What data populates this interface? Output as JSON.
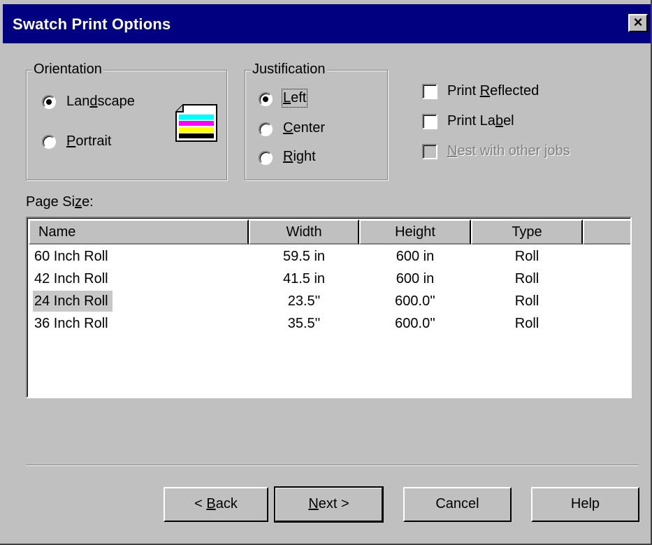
{
  "window": {
    "title": "Swatch Print Options",
    "close_symbol": "×"
  },
  "orientation": {
    "group_label": "Orientation",
    "options": [
      {
        "label_pre": "Lan",
        "label_u": "d",
        "label_post": "scape",
        "selected": true
      },
      {
        "label_pre": "",
        "label_u": "P",
        "label_post": "ortrait",
        "selected": false
      }
    ],
    "icon": "landscape-page-icon"
  },
  "justification": {
    "group_label": "Justification",
    "options": [
      {
        "label_pre": "",
        "label_u": "L",
        "label_post": "eft",
        "selected": true
      },
      {
        "label_pre": "",
        "label_u": "C",
        "label_post": "enter",
        "selected": false
      },
      {
        "label_pre": "",
        "label_u": "R",
        "label_post": "ight",
        "selected": false
      }
    ]
  },
  "checkboxes": [
    {
      "label_pre": "Print ",
      "label_u": "R",
      "label_post": "eflected",
      "checked": false,
      "enabled": true
    },
    {
      "label_pre": "Print La",
      "label_u": "b",
      "label_post": "el",
      "checked": false,
      "enabled": true
    },
    {
      "label_pre": "",
      "label_u": "N",
      "label_post": "est with other jobs",
      "checked": false,
      "enabled": false
    }
  ],
  "page_size": {
    "label_pre": "Page Si",
    "label_u": "z",
    "label_post": "e:",
    "columns": [
      "Name",
      "Width",
      "Height",
      "Type"
    ],
    "rows": [
      {
        "name": "60 Inch Roll",
        "width": "59.5 in",
        "height": "600 in",
        "type": "Roll"
      },
      {
        "name": "42 Inch Roll",
        "width": "41.5 in",
        "height": "600 in",
        "type": "Roll"
      },
      {
        "name": "24 Inch Roll",
        "width": "23.5''",
        "height": "600.0''",
        "type": "Roll"
      },
      {
        "name": "36 Inch Roll",
        "width": "35.5''",
        "height": "600.0''",
        "type": "Roll"
      }
    ],
    "selected_row": 2
  },
  "buttons": {
    "back": {
      "pre": "< ",
      "u": "B",
      "post": "ack"
    },
    "next": {
      "pre": "",
      "u": "N",
      "post": "ext >"
    },
    "cancel": "Cancel",
    "help": "Help"
  },
  "colors": {
    "title_bar": "#000080",
    "dialog_bg": "#c0c0c0",
    "icon_cyan": "#00ffff",
    "icon_magenta": "#ff00ff",
    "icon_yellow": "#ffff00",
    "icon_black": "#000000"
  }
}
